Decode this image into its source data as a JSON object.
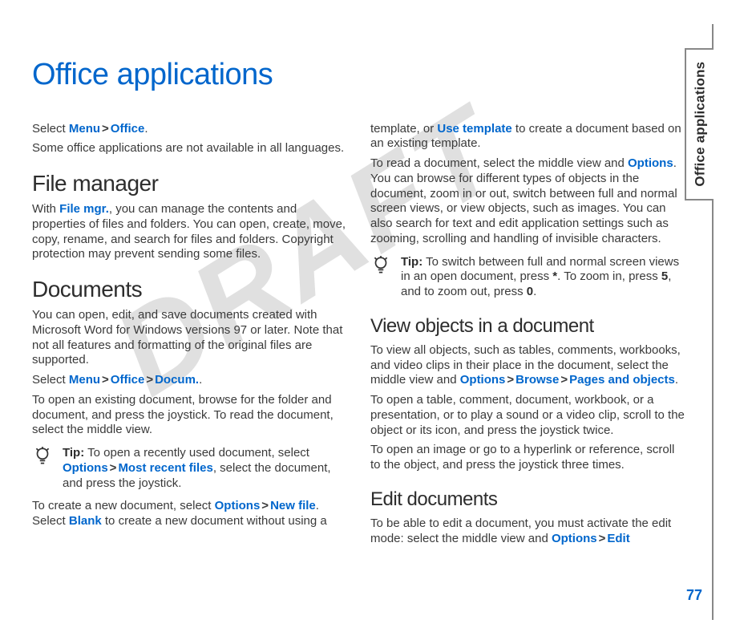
{
  "chapter_title": "Office applications",
  "tab_label": "Office applications",
  "page_number": "77",
  "watermark": "DRAFT",
  "ui": {
    "menu": "Menu",
    "office": "Office",
    "options": "Options",
    "docum": "Docum.",
    "browse": "Browse",
    "edit": "Edit",
    "file_mgr": "File mgr.",
    "most_recent_files": "Most recent files",
    "new_file": "New file",
    "blank": "Blank",
    "use_template": "Use template",
    "pages_and_objects": "Pages and objects"
  },
  "tip_label": "Tip:",
  "intro": {
    "select_prefix": "Select ",
    "select_suffix": ".",
    "not_available": "Some office applications are not available in all languages."
  },
  "file_manager": {
    "heading": "File manager",
    "p1_prefix": "With ",
    "p1_suffix": ", you can manage the contents and properties of files and folders. You can open, create, move, copy, rename, and search for files and folders. Copyright protection may prevent sending some files."
  },
  "documents": {
    "heading": "Documents",
    "p1": "You can open, edit, and save documents created with Microsoft Word for Windows versions 97 or later. Note that not all features and formatting of the original files are supported.",
    "p2_prefix": "Select ",
    "p2_suffix": ".",
    "p3": "To open an existing document, browse for the folder and document, and press the joystick. To read the document, select the middle view.",
    "tip1_a": "To open a recently used document, select ",
    "tip1_b": ", select the document, and press the joystick.",
    "p4_a": "To create a new document, select ",
    "p4_b": ". Select ",
    "p4_c": " to create a new document without using a",
    "p5_a": "template, or ",
    "p5_b": " to create a document based on an existing template.",
    "p6_a": "To read a document, select the middle view and ",
    "p6_b": ". You can browse for different types of objects in the document, zoom in or out, switch between full and normal screen views, or view objects, such as images. You can also search for text and edit application settings such as zooming, scrolling and handling of invisible characters.",
    "tip2_a": "To switch between full and normal screen views in an open document, press ",
    "tip2_b": ". To zoom in, press ",
    "tip2_c": ", and to zoom out, press ",
    "tip2_d": ".",
    "key_star": "*",
    "key_5": "5",
    "key_0": "0"
  },
  "view_objects": {
    "heading": "View objects in a document",
    "p1_a": "To view all objects, such as tables, comments, workbooks, and video clips in their place in the document, select the middle view and ",
    "p1_b": ".",
    "p2": "To open a table, comment, document, workbook, or a presentation, or to play a sound or a video clip, scroll to the object or its icon, and press the joystick twice.",
    "p3": "To open an image or go to a hyperlink or reference, scroll to the object, and press the joystick three times."
  },
  "edit_documents": {
    "heading": "Edit documents",
    "p1_a": "To be able to edit a document, you must activate the edit mode: select the middle view and ",
    "p1_b": ""
  }
}
